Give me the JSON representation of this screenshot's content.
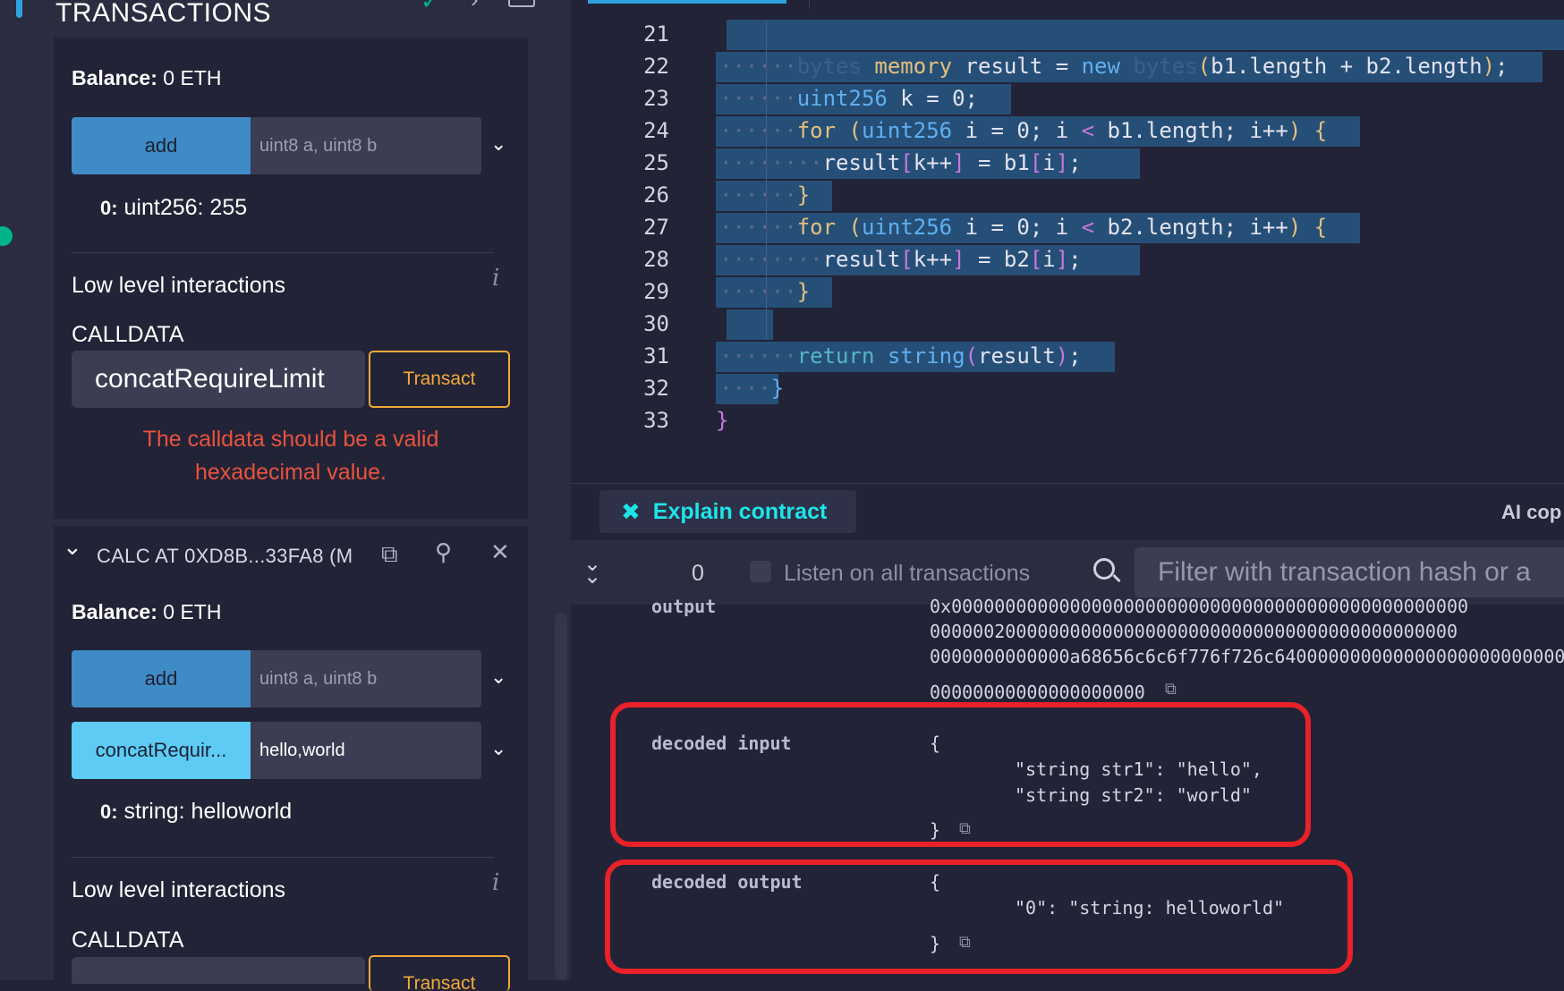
{
  "sidebar": {
    "section_title": "TRANSACTIONS",
    "card1": {
      "balance_label": "Balance:",
      "balance_value": "0 ETH",
      "fn_name": "add",
      "fn_placeholder": "uint8 a, uint8 b",
      "result_index": "0:",
      "result_value": "uint256: 255",
      "low_level_label": "Low level interactions",
      "calldata_label": "CALLDATA",
      "calldata_value": "concatRequireLimit",
      "transact_label": "Transact",
      "error_line1": "The calldata should be a valid",
      "error_line2": "hexadecimal value."
    },
    "instance": {
      "title": "CALC AT 0XD8B...33FA8 (M",
      "balance_label": "Balance:",
      "balance_value": "0 ETH",
      "fn1_name": "add",
      "fn1_placeholder": "uint8 a, uint8 b",
      "fn2_name": "concatRequir...",
      "fn2_value": "hello,world",
      "result_index": "0:",
      "result_value": "string: helloworld",
      "low_level_label": "Low level interactions",
      "calldata_label": "CALLDATA",
      "transact_label": "Transact"
    }
  },
  "editor": {
    "lines": [
      {
        "n": "21"
      },
      {
        "n": "22"
      },
      {
        "n": "23"
      },
      {
        "n": "24"
      },
      {
        "n": "25"
      },
      {
        "n": "26"
      },
      {
        "n": "27"
      },
      {
        "n": "28"
      },
      {
        "n": "29"
      },
      {
        "n": "30"
      },
      {
        "n": "31"
      },
      {
        "n": "32"
      },
      {
        "n": "33"
      }
    ]
  },
  "ai_bar": {
    "explain_label": "Explain contract",
    "copilot_label": "AI cop"
  },
  "terminal": {
    "count": "0",
    "listen_label": "Listen on all transactions",
    "filter_placeholder": "Filter with transaction hash or a",
    "output_key": "output",
    "output_lines": [
      "0x000000000000000000000000000000000000000000000000",
      "0000002000000000000000000000000000000000000000000",
      "0000000000000a68656c6c6f776f726c640000000000000000000000000",
      "00000000000000000000"
    ],
    "decoded_input_key": "decoded input",
    "decoded_input_lines": [
      "{",
      "\"string str1\": \"hello\",",
      "\"string str2\": \"world\"",
      "}"
    ],
    "decoded_output_key": "decoded output",
    "decoded_output_lines": [
      "{",
      "\"0\": \"string: helloworld\"",
      "}"
    ]
  },
  "colors": {
    "accent": "#2fa3e0",
    "transact": "#f2a93b",
    "error": "#e8523f",
    "annotation": "#e8212a",
    "explain": "#1ee4e8"
  }
}
